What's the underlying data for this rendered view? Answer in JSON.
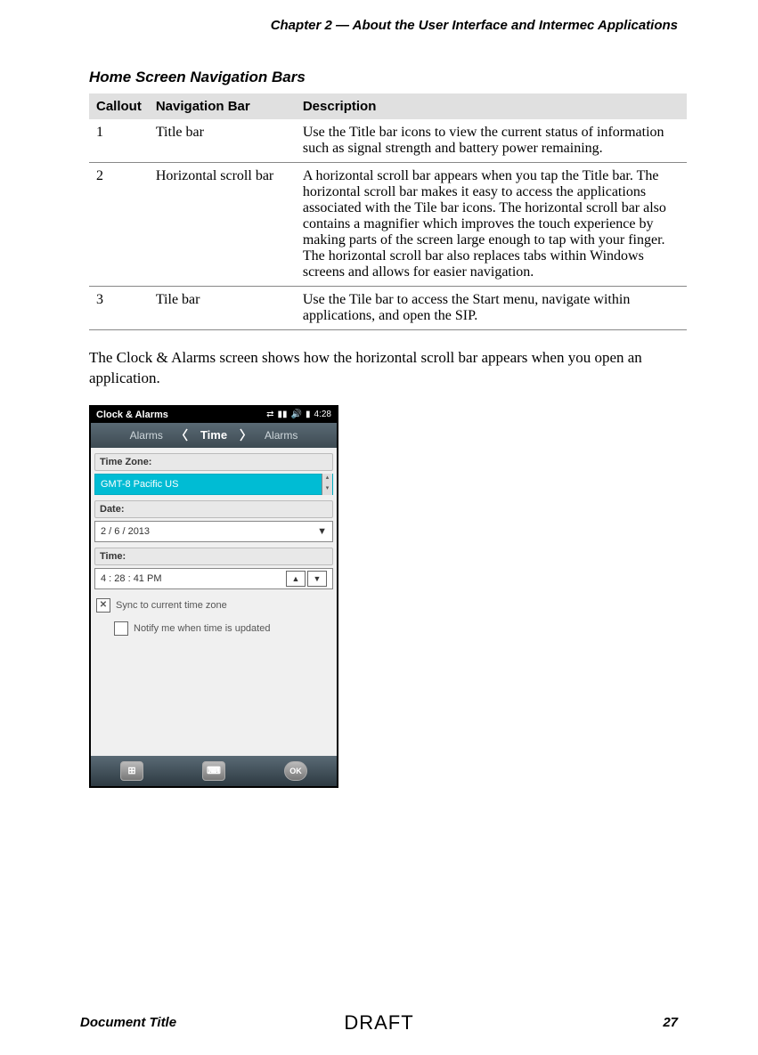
{
  "chapter_header": "Chapter 2 — About the User Interface and Intermec Applications",
  "section_title": "Home Screen Navigation Bars",
  "table": {
    "headers": [
      "Callout",
      "Navigation Bar",
      "Description"
    ],
    "rows": [
      {
        "callout": "1",
        "name": "Title bar",
        "desc": "Use the Title bar icons to view the current status of information such as signal strength and battery power remaining."
      },
      {
        "callout": "2",
        "name": "Horizontal scroll bar",
        "desc": "A horizontal scroll bar appears when you tap the Title bar. The horizontal scroll bar makes it easy to access the applications associated with the Tile bar icons. The horizontal scroll bar also contains a magnifier which improves the touch experience by making parts of the screen large enough to tap with your finger. The horizontal scroll bar also replaces tabs within Windows screens and allows for easier navigation."
      },
      {
        "callout": "3",
        "name": "Tile bar",
        "desc": "Use the Tile bar to access the Start menu, navigate within applications, and open the SIP."
      }
    ]
  },
  "body_text": "The Clock & Alarms screen shows how the horizontal scroll bar appears when you open an application.",
  "device": {
    "title": "Clock & Alarms",
    "clock": "4:28",
    "scroll": {
      "left": "Alarms",
      "center": "Time",
      "right": "Alarms"
    },
    "tz_label": "Time Zone:",
    "tz_value": "GMT-8 Pacific US",
    "date_label": "Date:",
    "date_value": "2  /  6  / 2013",
    "time_label": "Time:",
    "time_value": "4  :  28  :  41    PM",
    "sync_label": "Sync to current time zone",
    "notify_label": "Notify me when time is updated",
    "ok": "OK"
  },
  "footer": {
    "left": "Document Title",
    "center": "DRAFT",
    "right": "27"
  }
}
